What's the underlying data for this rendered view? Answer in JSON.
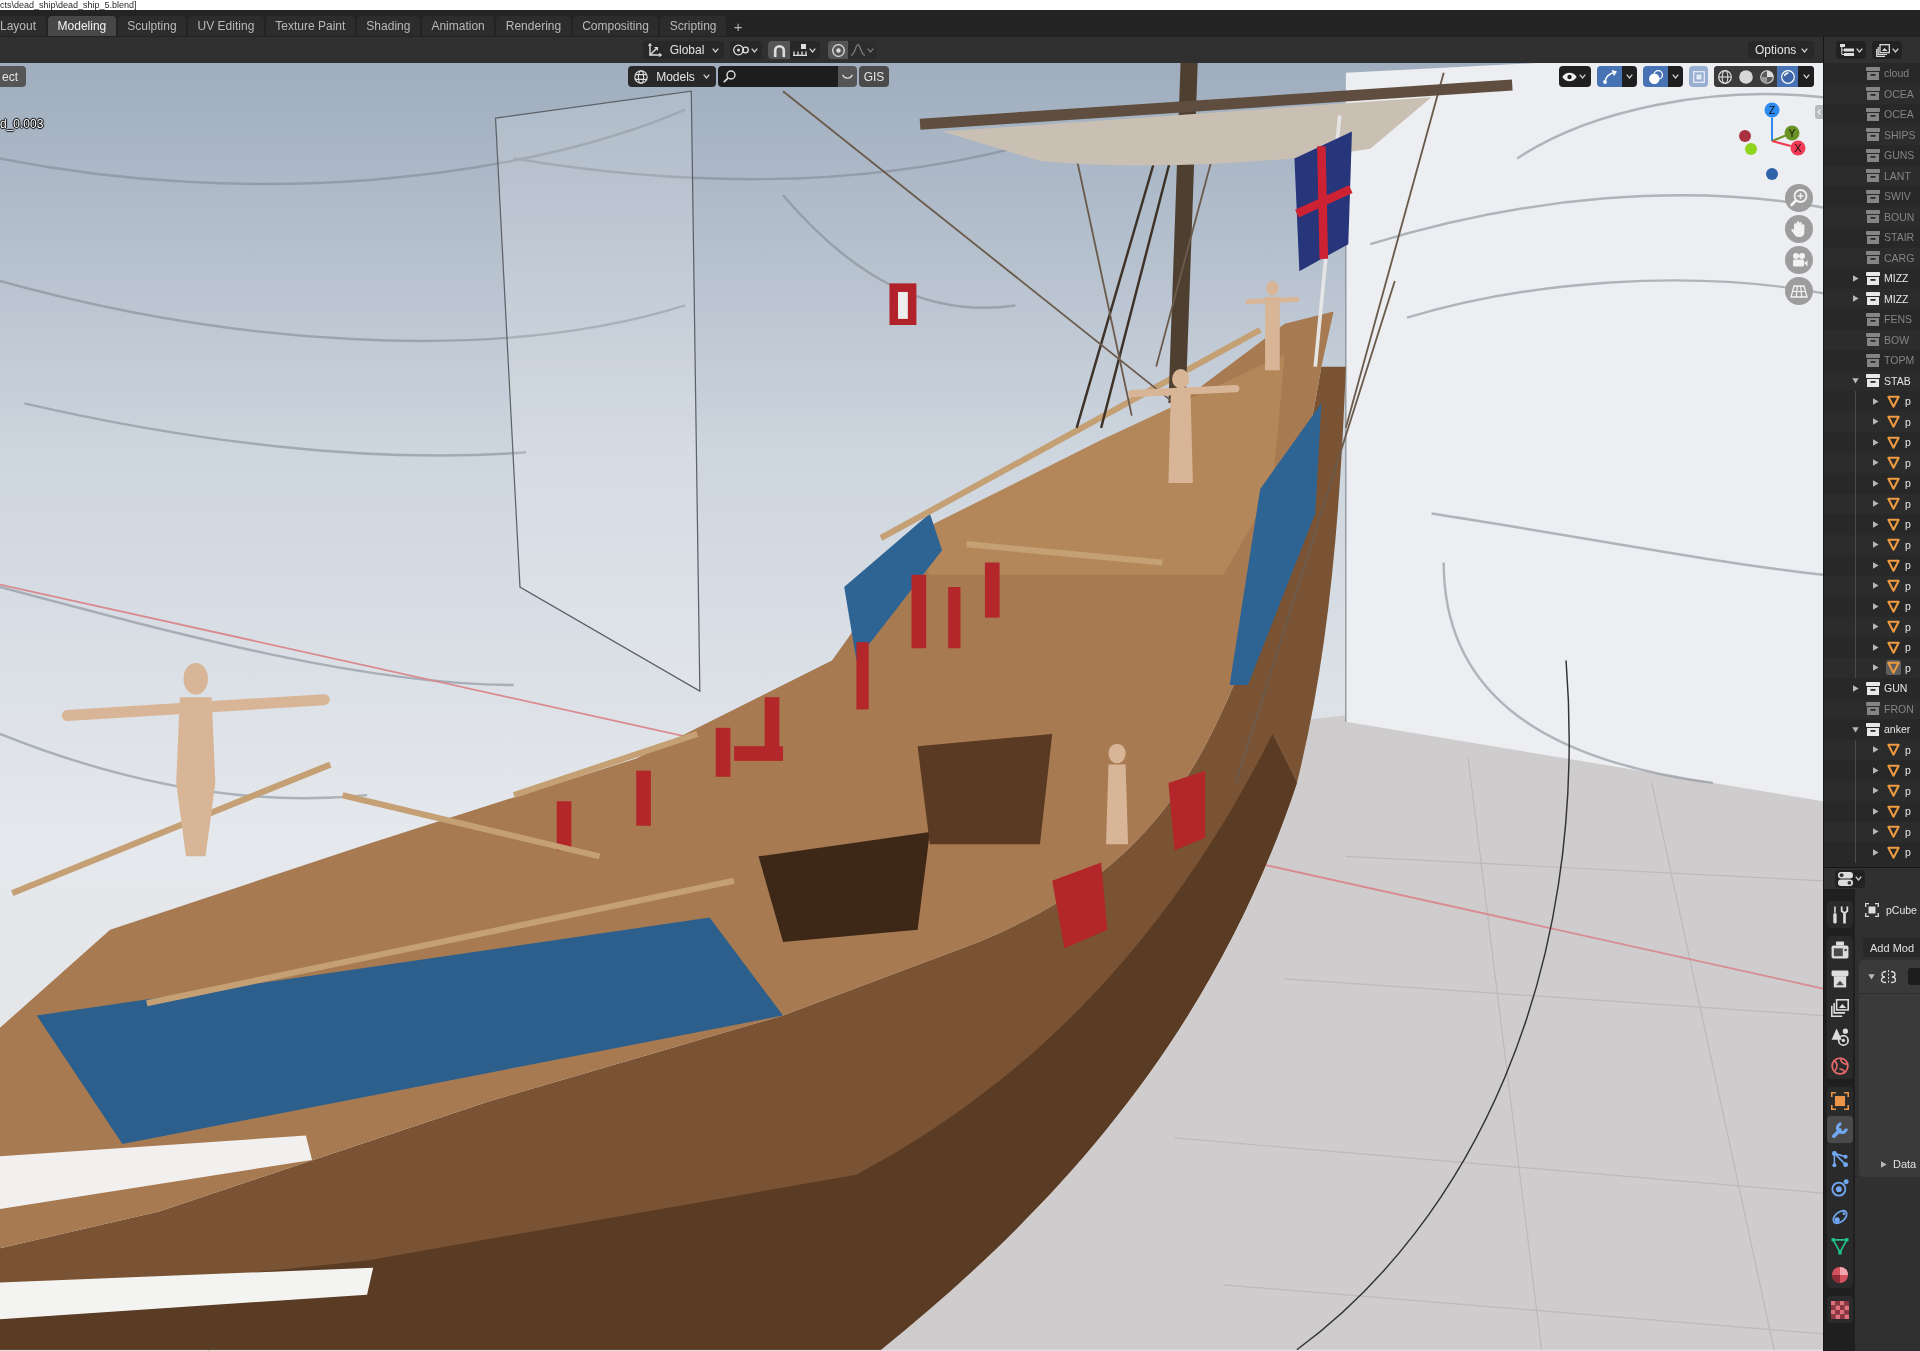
{
  "title_bar": {
    "path": "cts\\dead_ship\\dead_ship_5.blend]"
  },
  "workspace_tabs": [
    {
      "label": "Layout",
      "selected": false
    },
    {
      "label": "Modeling",
      "selected": true
    },
    {
      "label": "Sculpting",
      "selected": false
    },
    {
      "label": "UV Editing",
      "selected": false
    },
    {
      "label": "Texture Paint",
      "selected": false
    },
    {
      "label": "Shading",
      "selected": false
    },
    {
      "label": "Animation",
      "selected": false
    },
    {
      "label": "Rendering",
      "selected": false
    },
    {
      "label": "Compositing",
      "selected": false
    },
    {
      "label": "Scripting",
      "selected": false
    }
  ],
  "add_workspace_button": "+",
  "tool_header": {
    "transform_orientation": "Global",
    "snap": {
      "on": false
    },
    "proportional_editing": {
      "on": false
    },
    "options_menu": "Options"
  },
  "viewport": {
    "menu_button": "ect",
    "object_info": "d_0.003",
    "collection_menu": "Models",
    "filter_button": "GIS",
    "gizmos": {
      "on": true
    },
    "overlays": {
      "on": true
    },
    "xray": {
      "on": true,
      "disabled": true
    },
    "shading_modes": [
      {
        "kind": "wireframe",
        "selected": false
      },
      {
        "kind": "solid",
        "selected": false
      },
      {
        "kind": "material",
        "selected": false
      },
      {
        "kind": "rendered",
        "selected": true
      }
    ],
    "axes": [
      {
        "kind": "negative",
        "color": "#a8323f"
      },
      {
        "kind": "negative",
        "color": "#8fd41e"
      },
      {
        "kind": "negative",
        "color": "#2f62a8"
      },
      {
        "kind": "positive",
        "label": "Z",
        "color": "#2e8cf0"
      },
      {
        "kind": "positive",
        "label": "Y",
        "color": "#6b9224"
      },
      {
        "kind": "positive",
        "label": "X",
        "color": "#f23a56"
      }
    ]
  },
  "outliner": {
    "items": [
      {
        "kind": "collection",
        "label": "cloud",
        "disabled": true
      },
      {
        "kind": "collection",
        "label": "OCEA",
        "disabled": true
      },
      {
        "kind": "collection",
        "label": "OCEA",
        "disabled": true
      },
      {
        "kind": "collection",
        "label": "SHIPS",
        "disabled": true
      },
      {
        "kind": "collection",
        "label": "GUNS",
        "disabled": true
      },
      {
        "kind": "collection",
        "label": "LANT",
        "disabled": true
      },
      {
        "kind": "collection",
        "label": "SWIV",
        "disabled": true
      },
      {
        "kind": "collection",
        "label": "BOUN",
        "disabled": true
      },
      {
        "kind": "collection",
        "label": "STAIR",
        "disabled": true
      },
      {
        "kind": "collection",
        "label": "CARG",
        "disabled": true
      },
      {
        "kind": "collection",
        "label": "MIZZ",
        "disabled": false,
        "expanded": false
      },
      {
        "kind": "collection",
        "label": "MIZZ",
        "disabled": false,
        "expanded": false
      },
      {
        "kind": "collection",
        "label": "FENS",
        "disabled": true
      },
      {
        "kind": "collection",
        "label": "BOW",
        "disabled": true
      },
      {
        "kind": "collection",
        "label": "TOPM",
        "disabled": true
      },
      {
        "kind": "collection",
        "label": "STAB",
        "disabled": false,
        "expanded": true,
        "children": [
          {
            "kind": "mesh",
            "label": "p",
            "expanded": false,
            "active": false
          },
          {
            "kind": "mesh",
            "label": "p",
            "expanded": false,
            "active": false
          },
          {
            "kind": "mesh",
            "label": "p",
            "expanded": false,
            "active": false
          },
          {
            "kind": "mesh",
            "label": "p",
            "expanded": false,
            "active": false
          },
          {
            "kind": "mesh",
            "label": "p",
            "expanded": false,
            "active": false
          },
          {
            "kind": "mesh",
            "label": "p",
            "expanded": false,
            "active": false
          },
          {
            "kind": "mesh",
            "label": "p",
            "expanded": false,
            "active": false
          },
          {
            "kind": "mesh",
            "label": "p",
            "expanded": false,
            "active": false
          },
          {
            "kind": "mesh",
            "label": "p",
            "expanded": false,
            "active": false
          },
          {
            "kind": "mesh",
            "label": "p",
            "expanded": false,
            "active": false
          },
          {
            "kind": "mesh",
            "label": "p",
            "expanded": false,
            "active": false
          },
          {
            "kind": "mesh",
            "label": "p",
            "expanded": false,
            "active": false
          },
          {
            "kind": "mesh",
            "label": "p",
            "expanded": false,
            "active": false
          },
          {
            "kind": "mesh",
            "label": "p",
            "expanded": false,
            "active": true
          }
        ]
      },
      {
        "kind": "collection",
        "label": "GUN",
        "disabled": false,
        "expanded": false
      },
      {
        "kind": "collection",
        "label": "FRON",
        "disabled": true
      },
      {
        "kind": "collection",
        "label": "anker",
        "disabled": false,
        "expanded": true,
        "children": [
          {
            "kind": "mesh",
            "label": "p",
            "expanded": false,
            "active": false
          },
          {
            "kind": "mesh",
            "label": "p",
            "expanded": false,
            "active": false
          },
          {
            "kind": "mesh",
            "label": "p",
            "expanded": false,
            "active": false
          },
          {
            "kind": "mesh",
            "label": "p",
            "expanded": false,
            "active": false
          },
          {
            "kind": "mesh",
            "label": "p",
            "expanded": false,
            "active": false
          },
          {
            "kind": "mesh",
            "label": "p",
            "expanded": false,
            "active": false
          }
        ]
      }
    ]
  },
  "properties": {
    "tab_groups": [
      [
        {
          "kind": "tool",
          "selected": false
        }
      ],
      [
        {
          "kind": "render",
          "selected": false
        },
        {
          "kind": "output",
          "selected": false
        },
        {
          "kind": "view_layer",
          "selected": false
        },
        {
          "kind": "scene",
          "selected": false
        },
        {
          "kind": "world",
          "selected": false
        }
      ],
      [
        {
          "kind": "object",
          "selected": false
        },
        {
          "kind": "modifiers",
          "selected": true
        },
        {
          "kind": "particles",
          "selected": false
        },
        {
          "kind": "physics",
          "selected": false
        },
        {
          "kind": "constraints",
          "selected": false
        },
        {
          "kind": "data",
          "selected": false
        },
        {
          "kind": "material",
          "selected": false
        }
      ],
      [
        {
          "kind": "texture",
          "selected": false
        }
      ]
    ],
    "object_name": "pCube",
    "add_modifier_button": "Add Mod",
    "modifier": {
      "expanded": true,
      "subpanels": [
        {
          "label": "Data",
          "expanded": false
        }
      ]
    }
  }
}
